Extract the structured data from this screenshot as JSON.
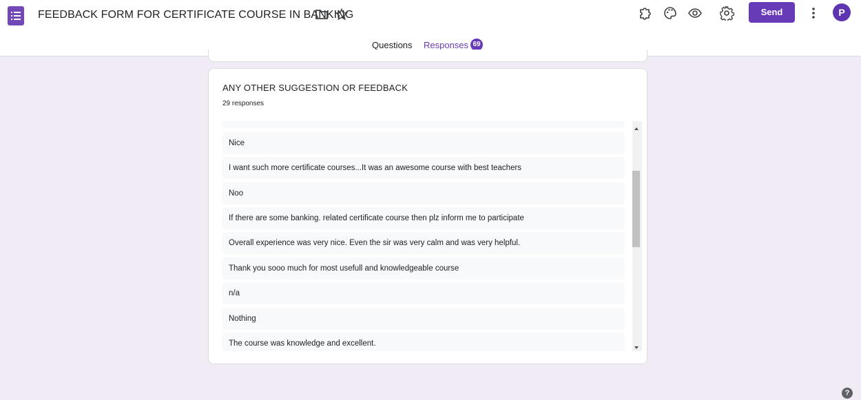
{
  "header": {
    "title": "FEEDBACK FORM FOR CERTIFICATE COURSE IN BANKING",
    "send_label": "Send",
    "avatar_letter": "P",
    "icons": [
      "forms-app-icon",
      "folder-icon",
      "star-icon",
      "addon-puzzle-icon",
      "palette-icon",
      "preview-eye-icon",
      "settings-gear-icon",
      "more-vert-icon"
    ]
  },
  "tabs": {
    "questions": "Questions",
    "responses": "Responses",
    "responses_count": "69"
  },
  "card": {
    "question": "ANY OTHER SUGGESTION OR FEEDBACK",
    "response_count": "29 responses",
    "responses": [
      "Nice",
      "I want such more certificate courses...It was an awesome course with best teachers",
      "Noo",
      "If there are some banking. related certificate course then plz inform me to participate",
      "Overall experience was very nice. Even the sir was very calm and was very helpful.",
      "Thank you sooo much for most usefull and knowledgeable course",
      "n/a",
      "Nothing",
      "The course was knowledge and excellent."
    ]
  },
  "help_label": "?",
  "colors": {
    "accent": "#673ab7",
    "background": "#f1ebf6",
    "response_bg": "#f8f9fa"
  }
}
